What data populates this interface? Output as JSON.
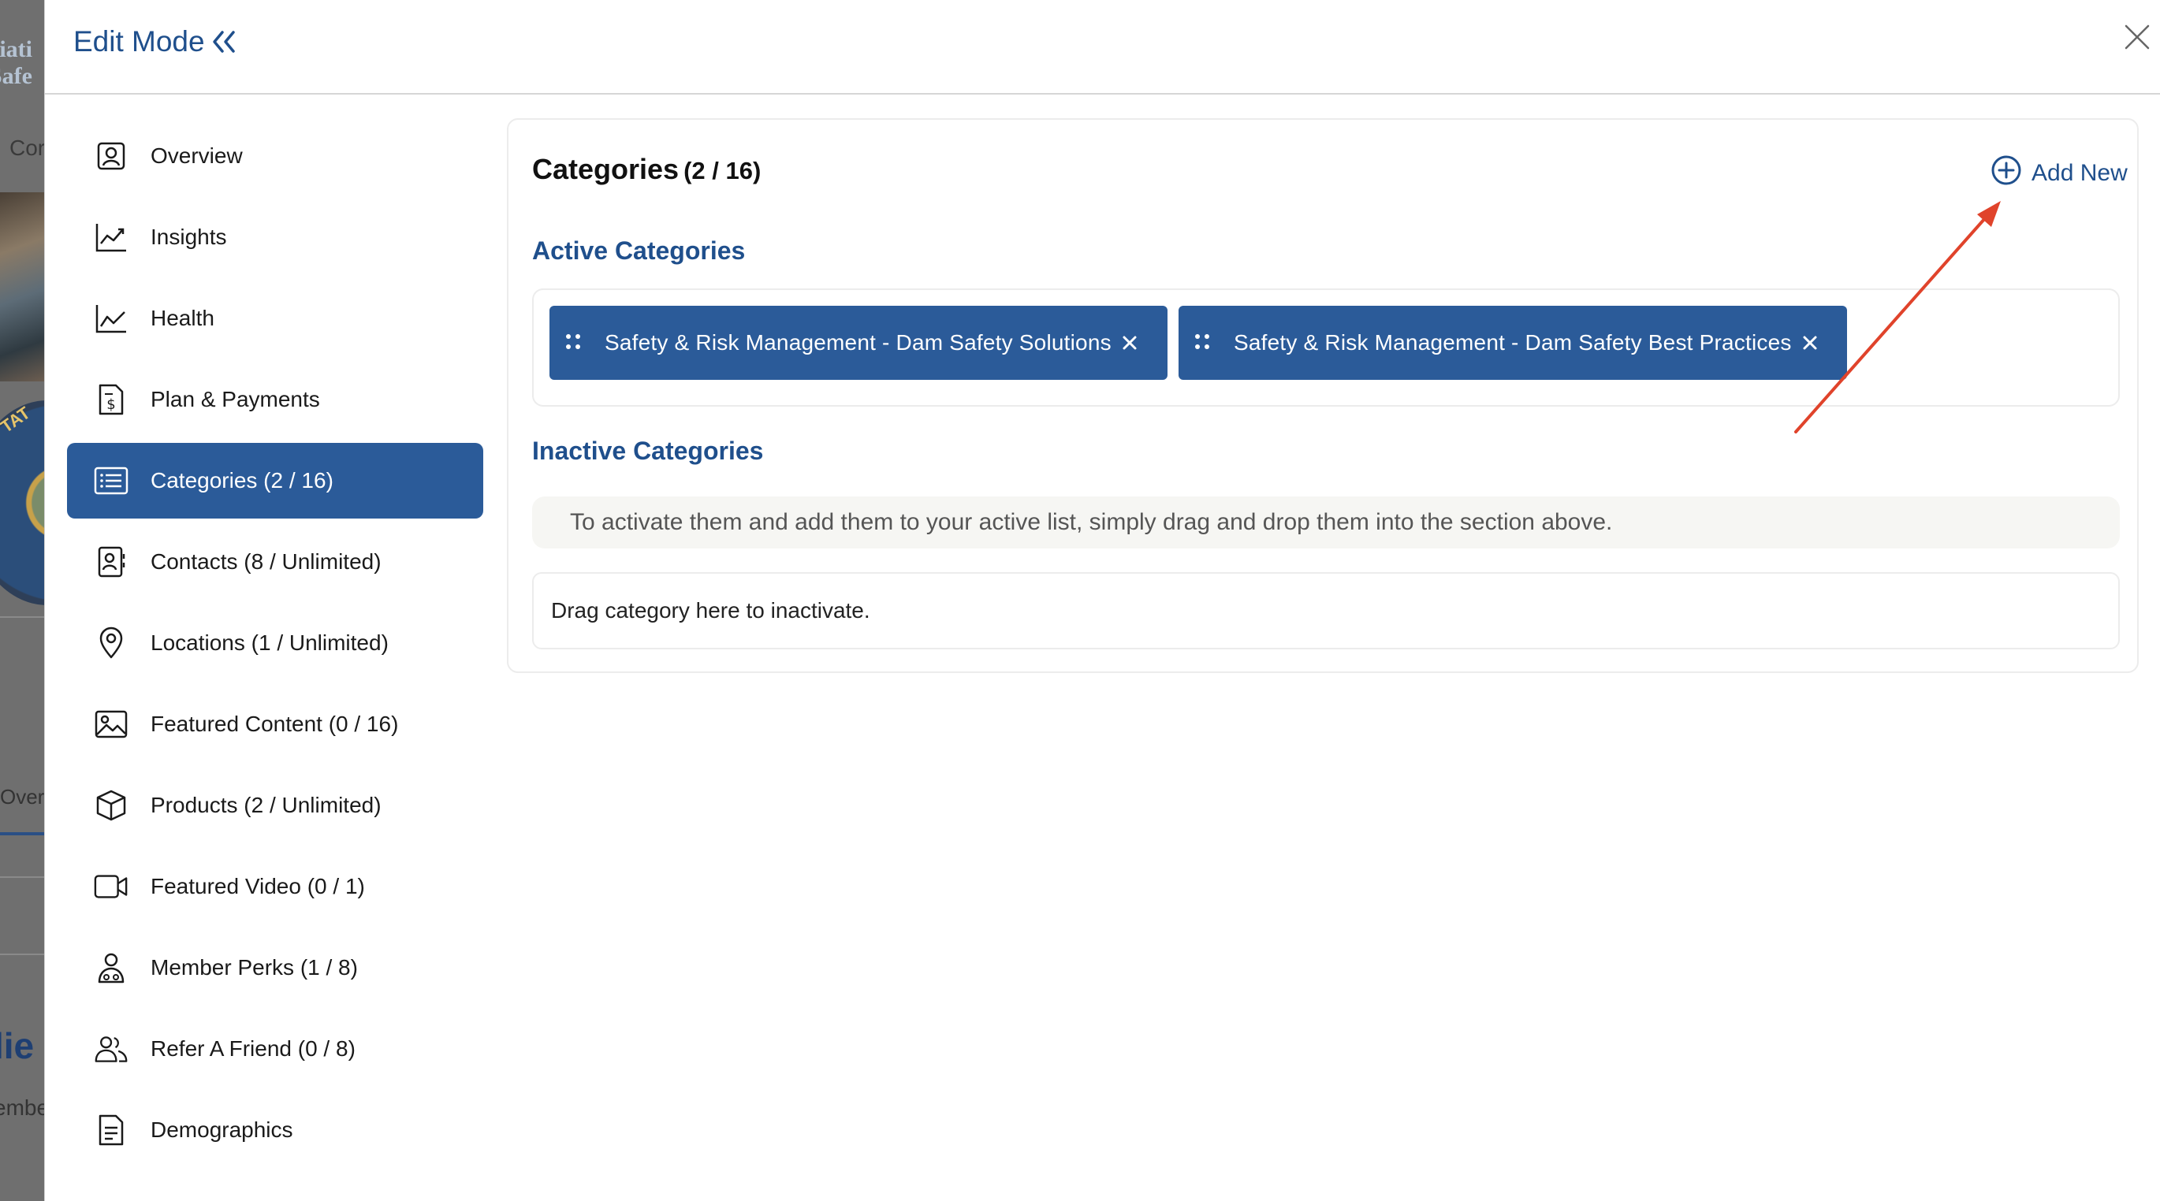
{
  "background": {
    "logo_lines": [
      "ciati",
      "Safe"
    ],
    "nav_text": "Cor",
    "seal_text": "TAT",
    "tab_text": "Over",
    "big_text": "lie",
    "small_text": "embe"
  },
  "header": {
    "title": "Edit Mode"
  },
  "sidebar": {
    "items": [
      {
        "label": "Overview",
        "icon": "user-square-icon"
      },
      {
        "label": "Insights",
        "icon": "trend-chart-icon"
      },
      {
        "label": "Health",
        "icon": "line-chart-icon"
      },
      {
        "label": "Plan & Payments",
        "icon": "invoice-dollar-icon"
      },
      {
        "label": "Categories (2 / 16)",
        "icon": "list-icon",
        "active": true
      },
      {
        "label": "Contacts (8 / Unlimited)",
        "icon": "contact-card-icon"
      },
      {
        "label": "Locations (1 / Unlimited)",
        "icon": "map-pin-icon"
      },
      {
        "label": "Featured Content (0 / 16)",
        "icon": "image-icon"
      },
      {
        "label": "Products (2 / Unlimited)",
        "icon": "box-icon"
      },
      {
        "label": "Featured Video (0 / 1)",
        "icon": "video-camera-icon"
      },
      {
        "label": "Member Perks (1 / 8)",
        "icon": "member-perks-icon"
      },
      {
        "label": "Refer A Friend (0 / 8)",
        "icon": "users-icon"
      },
      {
        "label": "Demographics",
        "icon": "document-icon"
      }
    ]
  },
  "panel": {
    "title": "Categories",
    "count": "(2 / 16)",
    "add_new_label": "Add New",
    "active_heading": "Active Categories",
    "active_chips": [
      "Safety & Risk Management - Dam Safety Solutions",
      "Safety & Risk Management - Dam Safety Best Practices"
    ],
    "inactive_heading": "Inactive Categories",
    "hint_text": "To activate them and add them to your active list, simply drag and drop them into the section above.",
    "drop_zone_text": "Drag category here to inactivate."
  },
  "colors": {
    "accent": "#2b5b99",
    "link": "#1f4f8c",
    "annotation": "#e0432b"
  }
}
